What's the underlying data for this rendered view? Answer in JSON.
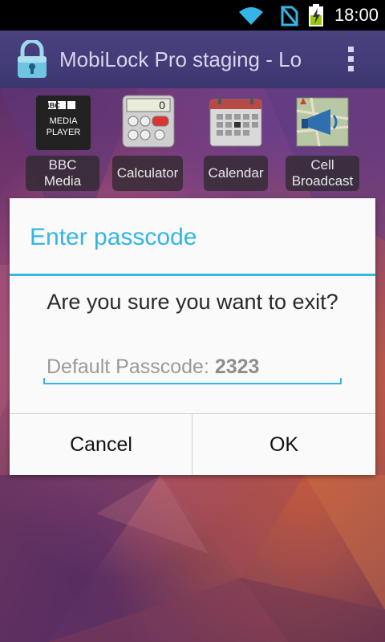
{
  "status_bar": {
    "time": "18:00",
    "icons": [
      "wifi-icon",
      "no-sim-icon",
      "battery-charging-icon"
    ]
  },
  "action_bar": {
    "title": "MobiLock Pro staging - Lo",
    "icon": "lock-icon",
    "overflow": "overflow-menu-icon"
  },
  "apps": [
    {
      "label": "BBC\nMedia",
      "icon": "bbc-media-player-icon",
      "icon_text": [
        "BBC",
        "MEDIA",
        "PLAYER"
      ]
    },
    {
      "label": "Calculator",
      "icon": "calculator-icon",
      "icon_text": "0"
    },
    {
      "label": "Calendar",
      "icon": "calendar-icon"
    },
    {
      "label": "Cell\nBroadcast",
      "icon": "cell-broadcast-icon"
    }
  ],
  "dialog": {
    "title": "Enter passcode",
    "message": "Are you sure you want to exit?",
    "passcode_hint_prefix": "Default Passcode: ",
    "passcode_hint_value": "2323",
    "passcode_value": "",
    "cancel_label": "Cancel",
    "ok_label": "OK"
  },
  "colors": {
    "accent": "#33b5e5",
    "action_bar": "#3b3670",
    "dialog_bg": "#fafafa"
  }
}
